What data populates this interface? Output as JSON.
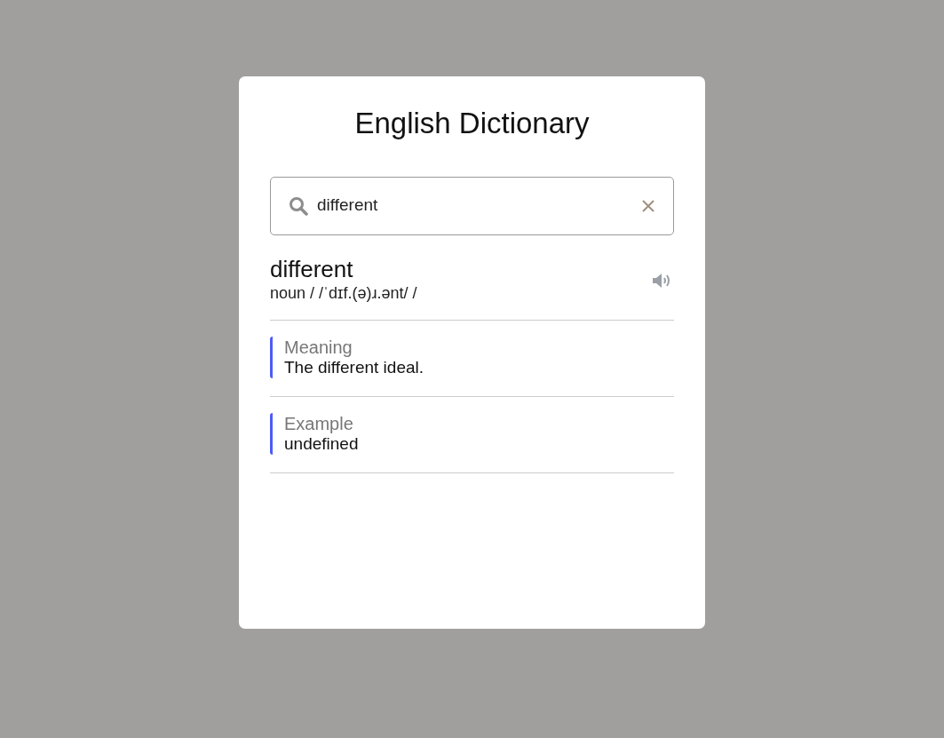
{
  "title": "English Dictionary",
  "search": {
    "value": "different"
  },
  "entry": {
    "word": "different",
    "phonetic": "noun / /ˈdɪf.(ə)ɹ.ənt/ /"
  },
  "sections": [
    {
      "label": "Meaning",
      "text": "The different ideal."
    },
    {
      "label": "Example",
      "text": "undefined"
    }
  ]
}
